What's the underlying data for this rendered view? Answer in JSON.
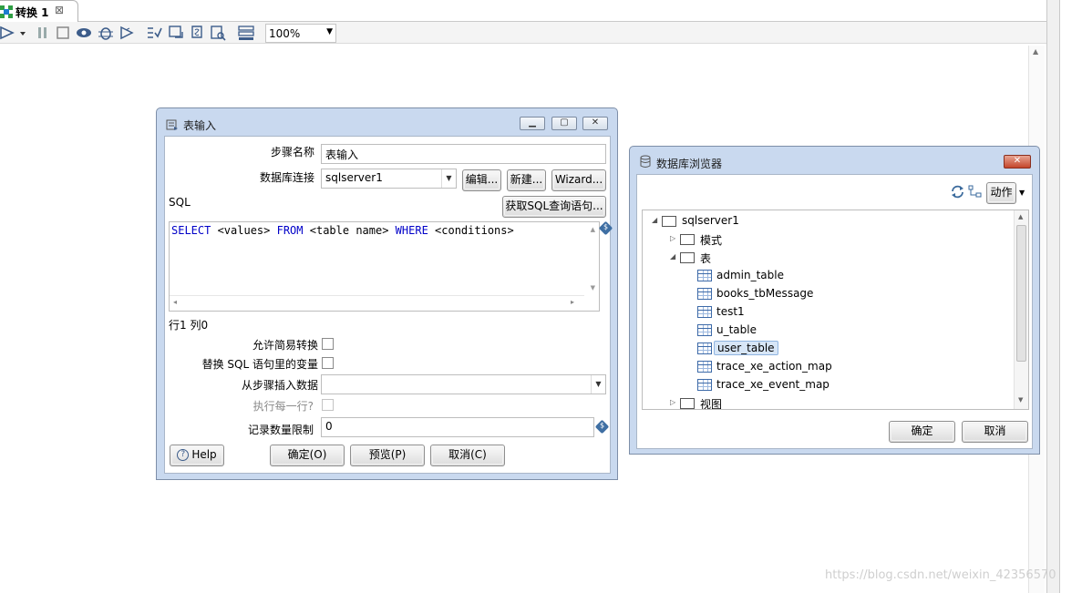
{
  "tab": {
    "label": "转换 1",
    "close": "⊠"
  },
  "toolbar": {
    "zoom": "100%"
  },
  "table_input": {
    "title": "表输入",
    "step_name_label": "步骤名称",
    "step_name_value": "表输入",
    "connection_label": "数据库连接",
    "connection_value": "sqlserver1",
    "edit_btn": "编辑...",
    "new_btn": "新建...",
    "wizard_btn": "Wizard...",
    "sql_label": "SQL",
    "get_sql_btn": "获取SQL查询语句...",
    "sql_tokens": [
      "SELECT",
      " <values> ",
      "FROM",
      " <table name> ",
      "WHERE",
      " <conditions>"
    ],
    "position_text": "行1 列0",
    "lazy_conversion_label": "允许简易转换",
    "replace_vars_label": "替换 SQL 语句里的变量",
    "insert_from_step_label": "从步骤插入数据",
    "execute_each_row_label": "执行每一行?",
    "limit_label": "记录数量限制",
    "limit_value": "0",
    "help_btn": "Help",
    "ok_btn": "确定(O)",
    "preview_btn": "预览(P)",
    "cancel_btn": "取消(C)"
  },
  "db_explorer": {
    "title": "数据库浏览器",
    "action_btn": "动作",
    "tree": {
      "root": "sqlserver1",
      "schemas": "模式",
      "tables": "表",
      "table_items": [
        "admin_table",
        "books_tbMessage",
        "test1",
        "u_table",
        "user_table",
        "trace_xe_action_map",
        "trace_xe_event_map"
      ],
      "selected": "user_table",
      "views": "视图"
    },
    "ok_btn": "确定",
    "cancel_btn": "取消"
  },
  "watermark": "https://blog.csdn.net/weixin_42356570"
}
